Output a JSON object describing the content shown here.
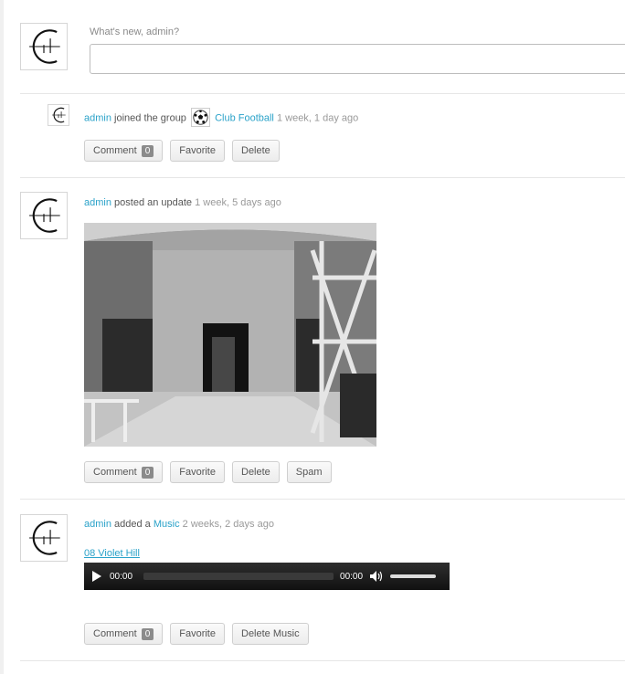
{
  "whats_new": {
    "label": "What's new, admin?",
    "placeholder": ""
  },
  "activity": [
    {
      "user": "admin",
      "action": "joined the group",
      "group": "Club Football",
      "time": "1 week, 1 day ago",
      "buttons": {
        "comment": "Comment",
        "comment_count": "0",
        "favorite": "Favorite",
        "delete": "Delete"
      }
    },
    {
      "user": "admin",
      "action": "posted an update",
      "time": "1 week, 5 days ago",
      "buttons": {
        "comment": "Comment",
        "comment_count": "0",
        "favorite": "Favorite",
        "delete": "Delete",
        "spam": "Spam"
      }
    },
    {
      "user": "admin",
      "action": "added a",
      "target": "Music",
      "time": "2 weeks, 2 days ago",
      "track": "08 Violet Hill",
      "player": {
        "current": "00:00",
        "duration": "00:00"
      },
      "buttons": {
        "comment": "Comment",
        "comment_count": "0",
        "favorite": "Favorite",
        "delete": "Delete Music"
      }
    }
  ],
  "icons": {
    "avatar": "avatar-logo-icon",
    "group": "soccer-ball-icon",
    "play": "play-icon",
    "volume": "speaker-icon"
  }
}
